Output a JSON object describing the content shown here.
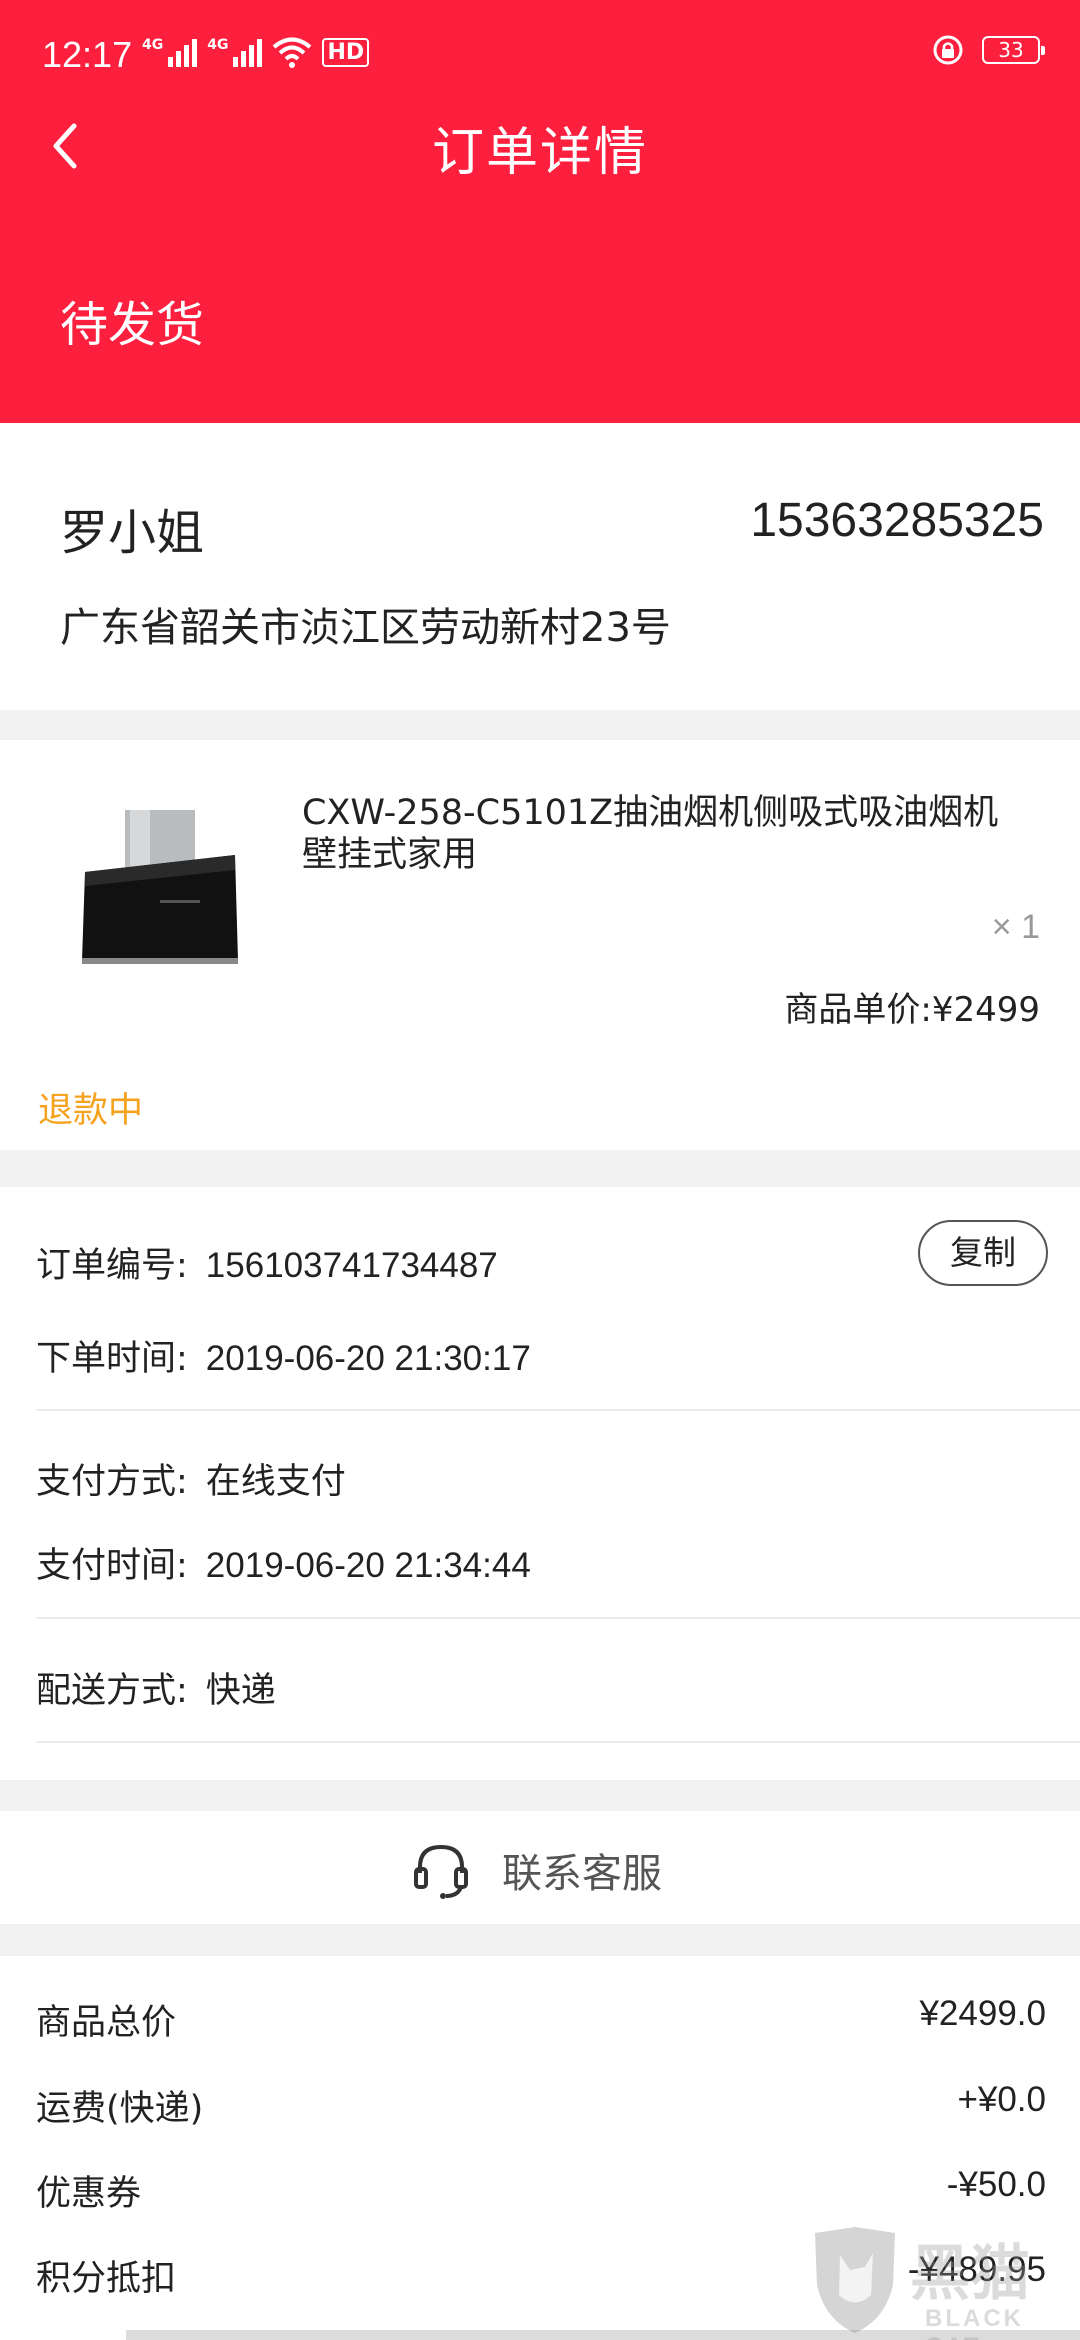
{
  "status_bar": {
    "time": "12:17",
    "network_1": "4G",
    "network_2": "4G",
    "hd_badge": "HD",
    "battery": "33"
  },
  "header": {
    "title": "订单详情",
    "order_status": "待发货",
    "background_color": "#fc1f3e"
  },
  "address": {
    "name": "罗小姐",
    "phone": "15363285325",
    "address": "广东省韶关市浈江区劳动新村23号"
  },
  "product": {
    "title": " CXW-258-C5101Z抽油烟机侧吸式吸油烟机壁挂式家用",
    "quantity": "× 1",
    "unit_price": "商品单价:¥2499",
    "refund_status": "退款中",
    "refund_color": "#f5a21f"
  },
  "order_info": {
    "order_no_label": "订单编号:",
    "order_no": "156103741734487",
    "copy_label": "复制",
    "order_time_label": "下单时间:",
    "order_time": "2019-06-20 21:30:17",
    "pay_method_label": "支付方式:",
    "pay_method": "在线支付",
    "pay_time_label": "支付时间:",
    "pay_time": "2019-06-20 21:34:44",
    "delivery_label": "配送方式:",
    "delivery": "快递"
  },
  "service": {
    "label": "联系客服",
    "icon": "headset-icon"
  },
  "summary": {
    "rows": [
      {
        "label": "商品总价",
        "value": "¥2499.0"
      },
      {
        "label": "运费(快递)",
        "value": "+¥0.0"
      },
      {
        "label": "优惠券",
        "value": "-¥50.0"
      },
      {
        "label": "积分抵扣",
        "value": "-¥489.95"
      }
    ]
  },
  "watermark": {
    "zh": "黑猫",
    "en": "BLACK CAT"
  }
}
